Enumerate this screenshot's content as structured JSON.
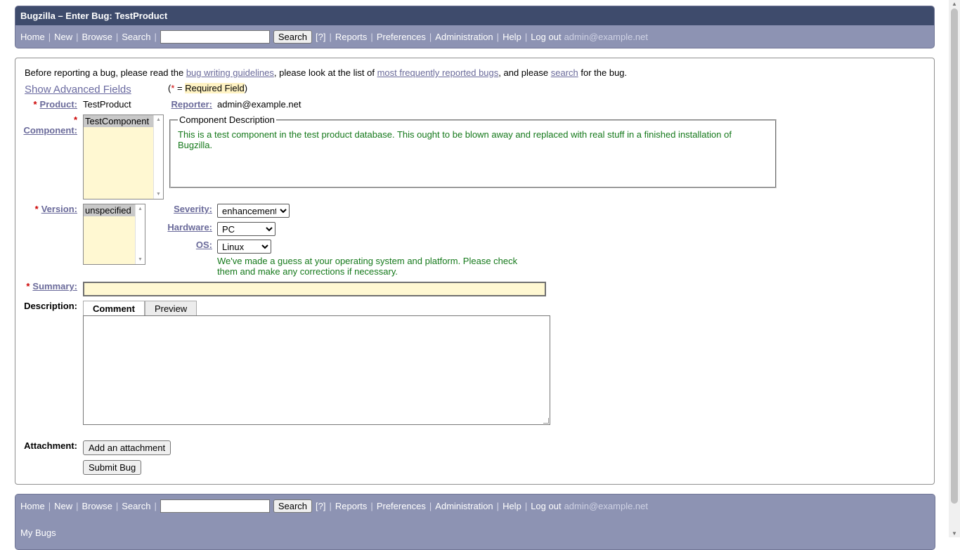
{
  "window": {
    "title": "Bugzilla – Enter Bug: TestProduct"
  },
  "nav": {
    "home": "Home",
    "new": "New",
    "browse": "Browse",
    "search": "Search",
    "search_button": "Search",
    "help_q": "[?]",
    "reports": "Reports",
    "preferences": "Preferences",
    "administration": "Administration",
    "help": "Help",
    "logout": "Log out",
    "user": "admin@example.net",
    "sep": "|"
  },
  "intro": {
    "t1": "Before reporting a bug, please read the ",
    "link1": "bug writing guidelines",
    "t2": ", please look at the list of ",
    "link2": "most frequently reported bugs",
    "t3": ", and please ",
    "link3": "search",
    "t4": " for the bug."
  },
  "show_advanced": "Show Advanced Fields",
  "required_note": {
    "open": "(",
    "star": "*",
    "eq": " = ",
    "text": "Required Field",
    "close": ")"
  },
  "form": {
    "star": "*",
    "product_label": "Product:",
    "product_value": "TestProduct",
    "reporter_label": "Reporter:",
    "reporter_value": "admin@example.net",
    "component_label": "Component:",
    "component_options": [
      "TestComponent"
    ],
    "component_desc_legend": "Component Description",
    "component_desc": "This is a test component in the test product database. This ought to be blown away and replaced with real stuff in a finished installation of Bugzilla.",
    "version_label": "Version:",
    "version_options": [
      "unspecified"
    ],
    "severity_label": "Severity:",
    "severity_value": "enhancement",
    "hardware_label": "Hardware:",
    "hardware_value": "PC",
    "os_label": "OS:",
    "os_value": "Linux",
    "os_guess": "We've made a guess at your operating system and platform. Please check them and make any corrections if necessary.",
    "summary_label": "Summary:",
    "summary_value": "",
    "description_label": "Description:",
    "tab_comment": "Comment",
    "tab_preview": "Preview",
    "description_value": "",
    "attachment_label": "Attachment:",
    "add_attachment": "Add an attachment",
    "submit": "Submit Bug"
  },
  "footer": {
    "my_bugs": "My Bugs"
  }
}
